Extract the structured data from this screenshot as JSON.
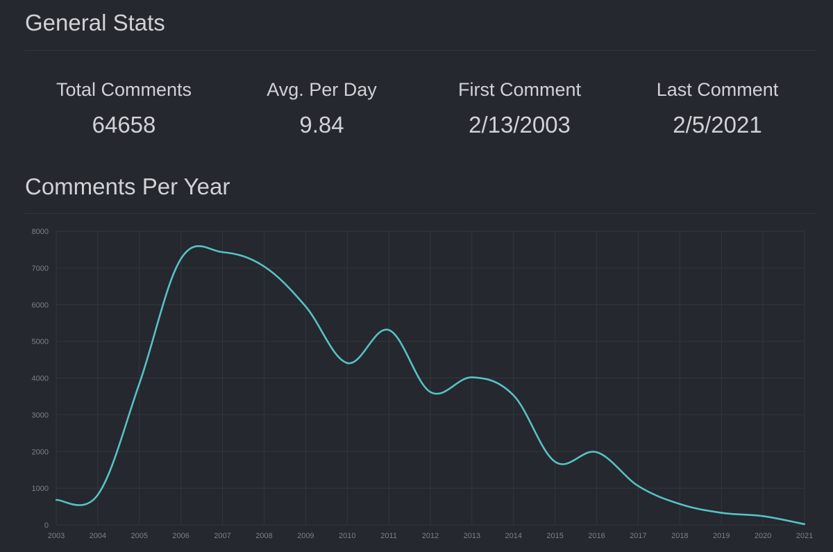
{
  "general": {
    "title": "General Stats",
    "stats": [
      {
        "label": "Total Comments",
        "value": "64658"
      },
      {
        "label": "Avg. Per Day",
        "value": "9.84"
      },
      {
        "label": "First Comment",
        "value": "2/13/2003"
      },
      {
        "label": "Last Comment",
        "value": "2/5/2021"
      }
    ]
  },
  "comments_per_year": {
    "title": "Comments Per Year"
  },
  "colors": {
    "background": "#25282e",
    "line": "#56c2c6",
    "grid": "#33373e",
    "tick_text": "#7d8188"
  },
  "chart_data": {
    "type": "line",
    "title": "",
    "xlabel": "",
    "ylabel": "",
    "categories": [
      "2003",
      "2004",
      "2005",
      "2006",
      "2007",
      "2008",
      "2009",
      "2010",
      "2011",
      "2012",
      "2013",
      "2014",
      "2015",
      "2016",
      "2017",
      "2018",
      "2019",
      "2020",
      "2021"
    ],
    "y_ticks": [
      "0",
      "1000",
      "2000",
      "3000",
      "4000",
      "5000",
      "6000",
      "7000",
      "8000"
    ],
    "ylim": [
      0,
      8000
    ],
    "grid": true,
    "legend": "none",
    "series": [
      {
        "values": [
          680,
          820,
          3850,
          7250,
          7430,
          7040,
          5950,
          4410,
          5310,
          3620,
          4020,
          3530,
          1720,
          1980,
          1060,
          570,
          330,
          240,
          20
        ]
      }
    ]
  }
}
